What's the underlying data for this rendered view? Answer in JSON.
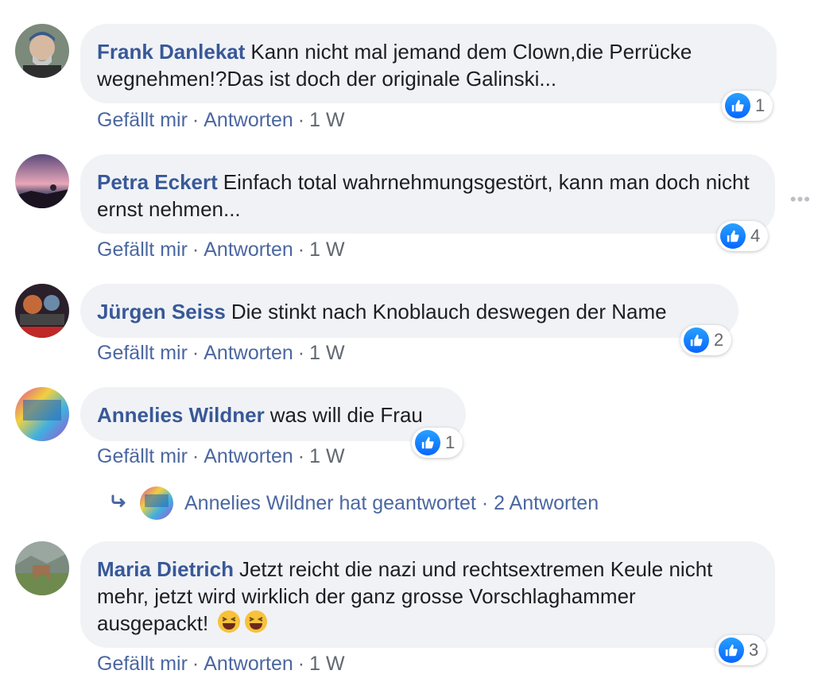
{
  "comments": [
    {
      "author": "Frank Danlekat",
      "text": "Kann nicht mal jemand dem Clown,die Perrücke wegnehmen!?Das ist doch der originale Galinski...",
      "like": "Gefällt mir",
      "reply": "Antworten",
      "time": "1 W",
      "reactions": "1"
    },
    {
      "author": "Petra Eckert",
      "text": "Einfach total wahrnehmungsgestört, kann man doch nicht ernst nehmen...",
      "like": "Gefällt mir",
      "reply": "Antworten",
      "time": "1 W",
      "reactions": "4"
    },
    {
      "author": "Jürgen Seiss",
      "text": "Die stinkt nach Knoblauch deswegen der Name",
      "like": "Gefällt mir",
      "reply": "Antworten",
      "time": "1 W",
      "reactions": "2"
    },
    {
      "author": "Annelies Wildner",
      "text": "was will die Frau",
      "like": "Gefällt mir",
      "reply": "Antworten",
      "time": "1 W",
      "reactions": "1"
    },
    {
      "author": "Maria Dietrich",
      "text": "Jetzt reicht die nazi und rechtsextremen Keule nicht mehr, jetzt wird wirklich der ganz grosse Vorschlaghammer ausgepackt!",
      "like": "Gefällt mir",
      "reply": "Antworten",
      "time": "1 W",
      "reactions": "3"
    }
  ],
  "reply_summary": "Annelies Wildner hat geantwortet · 2 Antworten",
  "more_menu": "•••",
  "colors": {
    "link": "#385898",
    "bubble": "#f0f2f5",
    "like": "#1877f2"
  },
  "icons": [
    "like-icon",
    "reply-arrow-icon",
    "laughing-emoji-icon",
    "more-options-icon"
  ]
}
